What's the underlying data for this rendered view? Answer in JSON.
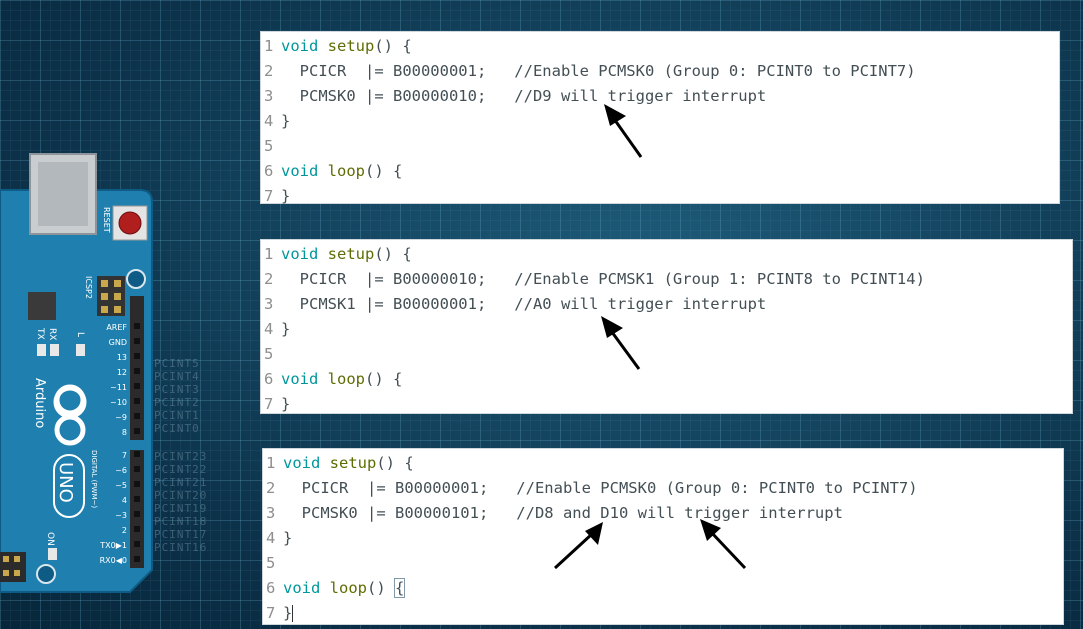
{
  "panels": [
    {
      "lines": [
        {
          "n": "1",
          "fold": true,
          "parts": [
            [
              "kw",
              "void"
            ],
            [
              "code",
              " "
            ],
            [
              "fn",
              "setup"
            ],
            [
              "code",
              "() {"
            ]
          ]
        },
        {
          "n": "2",
          "parts": [
            [
              "code",
              "  PCICR  |= B00000001;   "
            ],
            [
              "cm",
              "//Enable PCMSK0 (Group 0: PCINT0 to PCINT7)"
            ]
          ]
        },
        {
          "n": "3",
          "parts": [
            [
              "code",
              "  PCMSK0 |= B00000010;   "
            ],
            [
              "cm",
              "//D9 will trigger interrupt"
            ]
          ]
        },
        {
          "n": "4",
          "parts": [
            [
              "code",
              "}"
            ]
          ]
        },
        {
          "n": "5",
          "parts": []
        },
        {
          "n": "6",
          "fold": true,
          "parts": [
            [
              "kw",
              "void"
            ],
            [
              "code",
              " "
            ],
            [
              "fn",
              "loop"
            ],
            [
              "code",
              "() {"
            ]
          ]
        },
        {
          "n": "7",
          "parts": [
            [
              "code",
              "}"
            ]
          ]
        }
      ]
    },
    {
      "lines": [
        {
          "n": "1",
          "fold": true,
          "parts": [
            [
              "kw",
              "void"
            ],
            [
              "code",
              " "
            ],
            [
              "fn",
              "setup"
            ],
            [
              "code",
              "() {"
            ]
          ]
        },
        {
          "n": "2",
          "parts": [
            [
              "code",
              "  PCICR  |= B00000010;   "
            ],
            [
              "cm",
              "//Enable PCMSK1 (Group 1: PCINT8 to PCINT14)"
            ]
          ]
        },
        {
          "n": "3",
          "parts": [
            [
              "code",
              "  PCMSK1 |= B00000001;   "
            ],
            [
              "cm",
              "//A0 will trigger interrupt"
            ]
          ]
        },
        {
          "n": "4",
          "parts": [
            [
              "code",
              "}"
            ]
          ]
        },
        {
          "n": "5",
          "parts": []
        },
        {
          "n": "6",
          "fold": true,
          "parts": [
            [
              "kw",
              "void"
            ],
            [
              "code",
              " "
            ],
            [
              "fn",
              "loop"
            ],
            [
              "code",
              "() {"
            ]
          ]
        },
        {
          "n": "7",
          "parts": [
            [
              "code",
              "}"
            ]
          ]
        }
      ]
    },
    {
      "lines": [
        {
          "n": "1",
          "fold": true,
          "parts": [
            [
              "kw",
              "void"
            ],
            [
              "code",
              " "
            ],
            [
              "fn",
              "setup"
            ],
            [
              "code",
              "() {"
            ]
          ]
        },
        {
          "n": "2",
          "parts": [
            [
              "code",
              "  PCICR  |= B00000001;   "
            ],
            [
              "cm",
              "//Enable PCMSK0 (Group 0: PCINT0 to PCINT7)"
            ]
          ]
        },
        {
          "n": "3",
          "parts": [
            [
              "code",
              "  PCMSK0 |= B00000101;   "
            ],
            [
              "cm",
              "//D8 and D10 will trigger interrupt"
            ]
          ]
        },
        {
          "n": "4",
          "parts": [
            [
              "code",
              "}"
            ]
          ]
        },
        {
          "n": "5",
          "parts": []
        },
        {
          "n": "6",
          "fold": true,
          "parts": [
            [
              "kw",
              "void"
            ],
            [
              "code",
              " "
            ],
            [
              "fn",
              "loop"
            ],
            [
              "code",
              "() "
            ],
            [
              "box",
              "{"
            ]
          ]
        },
        {
          "n": "7",
          "parts": [
            [
              "code",
              "}"
            ],
            [
              "cursor",
              ""
            ]
          ]
        }
      ]
    }
  ],
  "board": {
    "reset_label": "RESET",
    "icsp_label": "ICSP2",
    "brand": "Arduino",
    "model": "UNO",
    "digital_label": "DIGITAL (PWM~)",
    "led_labels": [
      "TX",
      "RX",
      "L"
    ],
    "on_label": "ON",
    "pin_labels": [
      "AREF",
      "GND",
      "13",
      "12",
      "~11",
      "~10",
      "~9",
      "8",
      "7",
      "~6",
      "~5",
      "4",
      "~3",
      "2",
      "TX0▶1",
      "RX0◀0"
    ],
    "ghost_pcint": [
      "PCINT5",
      "PCINT4",
      "PCINT3",
      "PCINT2",
      "PCINT1",
      "PCINT0",
      "PCINT23",
      "PCINT22",
      "PCINT21",
      "PCINT20",
      "PCINT19",
      "PCINT18",
      "PCINT17",
      "PCINT16"
    ]
  },
  "colors": {
    "board_blue": "#1f7fae",
    "keyword": "#00979c",
    "function": "#5e6d03",
    "arrow": "#000000"
  }
}
